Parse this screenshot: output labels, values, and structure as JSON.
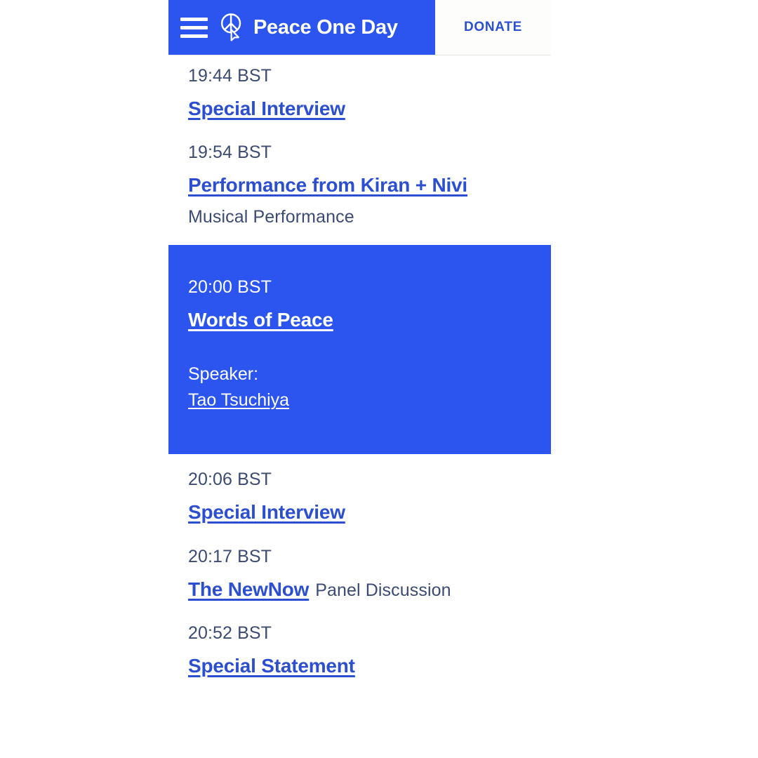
{
  "header": {
    "menu_icon": "hamburger-menu-icon",
    "logo_icon": "peace-sign-cursor-icon",
    "brand_title": "Peace One Day",
    "donate_label": "DONATE",
    "brand_bg_color": "#2b55ee",
    "donate_text_color": "#2b4fd0"
  },
  "theme": {
    "accent_blue": "#2b55ee",
    "link_blue": "#2b4fd0",
    "muted_text": "#3c4b72",
    "page_bg": "#ffffff",
    "highlight_text": "#ffffff"
  },
  "schedule": {
    "items": [
      {
        "time": "19:44 BST",
        "title": "Special Interview",
        "suffix": "",
        "subtitle": "",
        "highlighted": false,
        "speaker_label": "",
        "speaker_name": ""
      },
      {
        "time": "19:54 BST",
        "title": "Performance from Kiran + Nivi",
        "suffix": "",
        "subtitle": "Musical Performance",
        "highlighted": false,
        "speaker_label": "",
        "speaker_name": ""
      },
      {
        "time": "20:00 BST",
        "title": "Words of Peace",
        "suffix": "",
        "subtitle": "",
        "highlighted": true,
        "speaker_label": "Speaker:",
        "speaker_name": "Tao Tsuchiya"
      },
      {
        "time": "20:06 BST",
        "title": "Special Interview",
        "suffix": "",
        "subtitle": "",
        "highlighted": false,
        "speaker_label": "",
        "speaker_name": ""
      },
      {
        "time": "20:17 BST",
        "title": "The NewNow",
        "suffix": "Panel Discussion",
        "subtitle": "",
        "highlighted": false,
        "speaker_label": "",
        "speaker_name": ""
      },
      {
        "time": "20:52 BST",
        "title": "Special Statement",
        "suffix": "",
        "subtitle": "",
        "highlighted": false,
        "speaker_label": "",
        "speaker_name": ""
      }
    ]
  }
}
